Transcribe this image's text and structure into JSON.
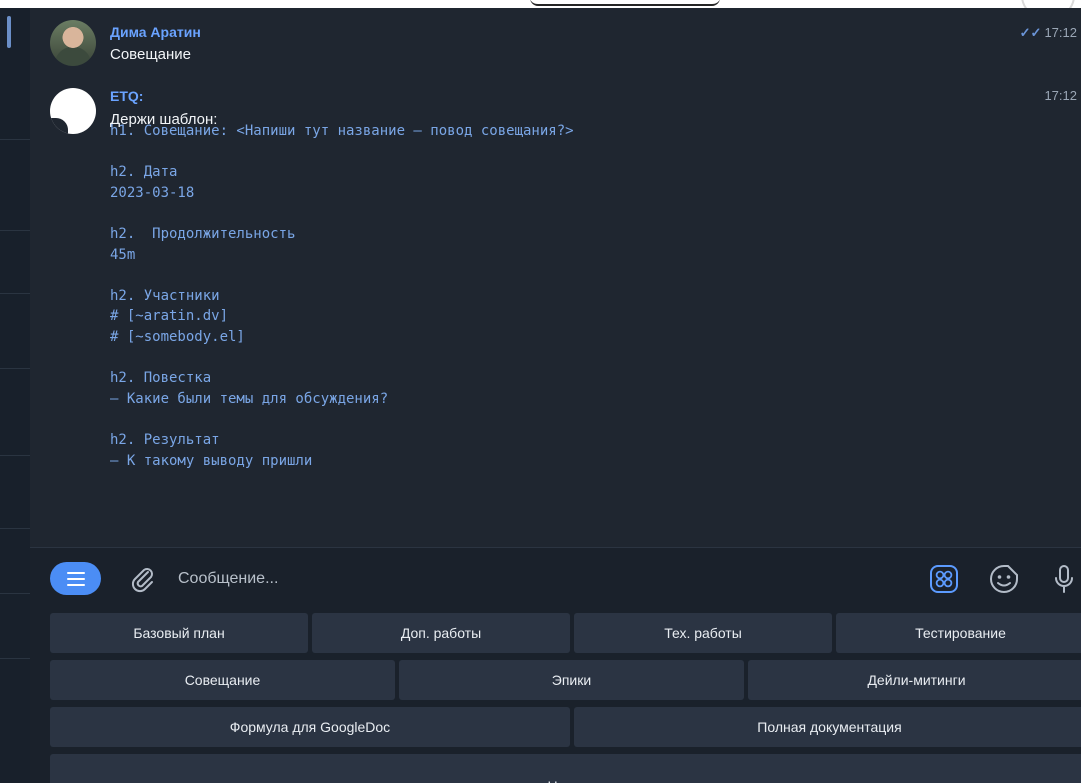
{
  "messages": [
    {
      "sender": "Дима Аратин",
      "text": "Совещание",
      "time": "17:12",
      "read_status": "✓✓"
    },
    {
      "sender": "ETQ:",
      "text": "Держи шаблон:",
      "time": "17:12",
      "code": "h1. Совещание: <Напиши тут название – повод совещания?>\n\nh2. Дата\n2023-03-18\n\nh2.  Продолжительность\n45m\n\nh2. Участники\n# [~aratin.dv]\n# [~somebody.el]\n\nh2. Повестка\n– Какие были темы для обсуждения?\n\nh2. Результат\n– К такому выводу пришли"
    }
  ],
  "composer": {
    "placeholder": "Сообщение..."
  },
  "keyboard": {
    "rows": [
      [
        "Базовый план",
        "Доп. работы",
        "Тех. работы",
        "Тестирование"
      ],
      [
        "Совещание",
        "Эпики",
        "Дейли-митинги"
      ],
      [
        "Формула для GoogleDoc",
        "Полная документация"
      ],
      [
        "Назад"
      ]
    ]
  },
  "colors": {
    "chat_bg": "#1f2630",
    "sender": "#6aa3ff",
    "code": "#7aa6e6",
    "key_bg": "#2b3443",
    "menu_btn": "#4b8df5"
  },
  "icons": [
    "menu-icon",
    "paperclip-icon",
    "emoji-grid-icon",
    "sticker-icon",
    "microphone-icon"
  ]
}
